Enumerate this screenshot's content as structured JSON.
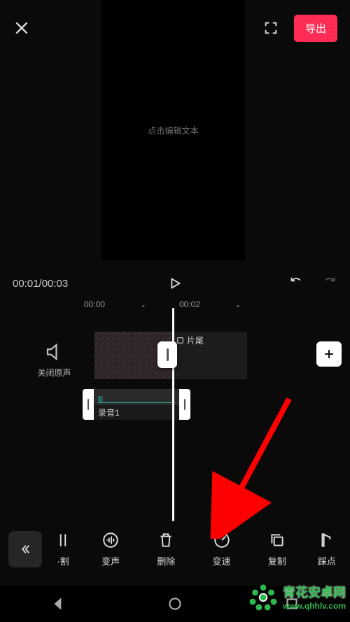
{
  "header": {
    "export_label": "导出"
  },
  "preview": {
    "placeholder_text": "点击编辑文本"
  },
  "player": {
    "current_time": "00:01",
    "total_time": "00:03",
    "time_display": "00:01/00:03"
  },
  "ruler": {
    "t0": "00:00",
    "t1": "00:02"
  },
  "tracks": {
    "mute_label": "关闭原声",
    "end_tag": "片尾",
    "audio_clip_name": "录音1"
  },
  "tools": {
    "back": "",
    "items": [
      {
        "id": "split",
        "label": "·割"
      },
      {
        "id": "voice-change",
        "label": "变声"
      },
      {
        "id": "delete",
        "label": "删除"
      },
      {
        "id": "speed",
        "label": "变速"
      },
      {
        "id": "copy",
        "label": "复制"
      },
      {
        "id": "beat",
        "label": "踩点"
      }
    ]
  },
  "watermark": {
    "brand": "青花安卓网",
    "url": "www.qhhlv.com"
  },
  "colors": {
    "accent": "#ff2d55",
    "teal": "#1fd7c7",
    "brand_green": "#2fb84f"
  }
}
